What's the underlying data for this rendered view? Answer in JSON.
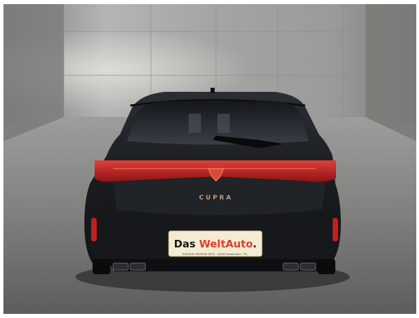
{
  "car": {
    "badge": "CUPRA"
  },
  "plate": {
    "brand_part1": "Das ",
    "brand_part2": "WeltAuto",
    "brand_part3": ".",
    "dealer_line": "PORSCHE ZENTRUM AUTO · 00000 Musterstadt · TEL."
  },
  "colors": {
    "body_paint": "#1b1d21",
    "taillight": "#c81e1e",
    "plate_bg": "#f4ecd2",
    "plate_accent": "#e0402a",
    "copper_badge": "#c79a7a"
  }
}
